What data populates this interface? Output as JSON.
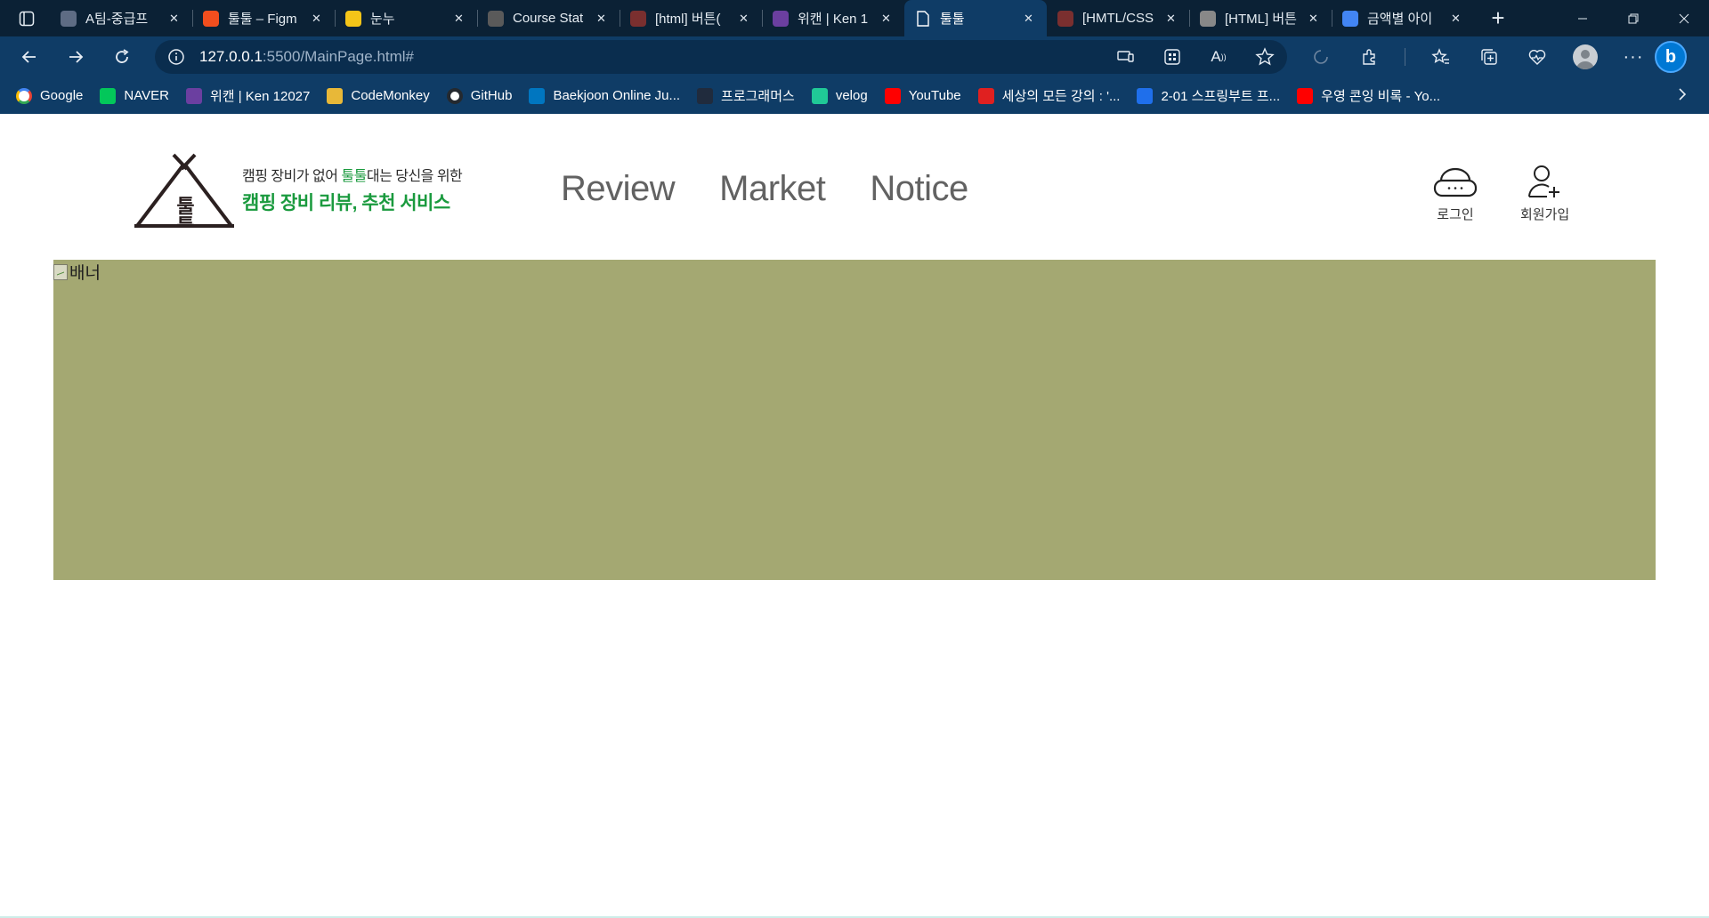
{
  "browser": {
    "tabs": [
      {
        "title": "A팀-중급프",
        "favicon": "trello-icon",
        "color": "#5e6c84",
        "active": false
      },
      {
        "title": "툴툴 – Figm",
        "favicon": "figma-icon",
        "color": "#f24e1e",
        "active": false
      },
      {
        "title": "눈누",
        "favicon": "chick-icon",
        "color": "#f5c518",
        "active": false
      },
      {
        "title": "Course Stat",
        "favicon": "apple-icon",
        "color": "#5a5a5a",
        "active": false
      },
      {
        "title": "[html] 버튼(",
        "favicon": "tistory-icon",
        "color": "#7a2f2f",
        "active": false
      },
      {
        "title": "위캔 | Ken 1",
        "favicon": "k-icon",
        "color": "#6b3fa0",
        "active": false
      },
      {
        "title": "툴툴",
        "favicon": "document-icon",
        "color": "#ffffff",
        "active": true
      },
      {
        "title": "[HMTL/CSS",
        "favicon": "tistory-icon",
        "color": "#7a2f2f",
        "active": false
      },
      {
        "title": "[HTML] 버튼",
        "favicon": "avatar-icon",
        "color": "#888888",
        "active": false
      },
      {
        "title": "금액별 아이",
        "favicon": "google-icon",
        "color": "#4285f4",
        "active": false
      }
    ],
    "address": {
      "host": "127.0.0.1",
      "path": ":5500/MainPage.html#"
    },
    "bookmarks": [
      {
        "label": "Google",
        "favicon": "google-icon",
        "color": "#ffffff"
      },
      {
        "label": "NAVER",
        "favicon": "naver-icon",
        "color": "#03c75a"
      },
      {
        "label": "위캔 | Ken 12027",
        "favicon": "k-icon",
        "color": "#6b3fa0"
      },
      {
        "label": "CodeMonkey",
        "favicon": "banana-icon",
        "color": "#e8b838"
      },
      {
        "label": "GitHub",
        "favicon": "github-icon",
        "color": "#24292f"
      },
      {
        "label": "Baekjoon Online Ju...",
        "favicon": "code-icon",
        "color": "#0076c0"
      },
      {
        "label": "프로그래머스",
        "favicon": "programmers-icon",
        "color": "#202b3d"
      },
      {
        "label": "velog",
        "favicon": "velog-icon",
        "color": "#20c997"
      },
      {
        "label": "YouTube",
        "favicon": "youtube-icon",
        "color": "#ff0000"
      },
      {
        "label": "세상의 모든 강의 : '...",
        "favicon": "play-icon",
        "color": "#e02020"
      },
      {
        "label": "2-01 스프링부트 프...",
        "favicon": "w-icon",
        "color": "#1f6feb"
      },
      {
        "label": "우영 콘잉 비록 - Yo...",
        "favicon": "youtube-icon",
        "color": "#ff0000"
      }
    ]
  },
  "site": {
    "logo": {
      "tagline_pre": "캠핑 장비가 없어 ",
      "tagline_highlight": "툴툴",
      "tagline_post": "대는 당신을 위한",
      "subtitle": "캠핑 장비 리뷰, 추천 서비스",
      "glyph": "툴툴"
    },
    "nav": {
      "review": "Review",
      "market": "Market",
      "notice": "Notice"
    },
    "auth": {
      "login": "로그인",
      "signup": "회원가입"
    },
    "banner": {
      "alt": "배너",
      "color": "#a4a872"
    },
    "colors": {
      "brand_green": "#1a9a3e",
      "nav_text": "#626262"
    }
  }
}
